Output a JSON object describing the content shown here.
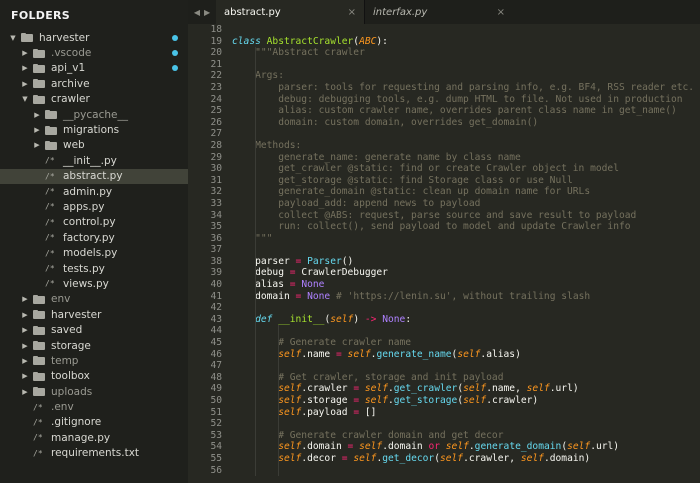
{
  "sidebar": {
    "header": "FOLDERS",
    "items": [
      {
        "label": "harvester",
        "kind": "folder",
        "open": true,
        "depth": 0,
        "dot": true,
        "dim": false
      },
      {
        "label": ".vscode",
        "kind": "folder",
        "open": false,
        "depth": 1,
        "dot": true,
        "dim": true
      },
      {
        "label": "api_v1",
        "kind": "folder",
        "open": false,
        "depth": 1,
        "dot": true,
        "dim": false
      },
      {
        "label": "archive",
        "kind": "folder",
        "open": false,
        "depth": 1,
        "dot": false,
        "dim": false
      },
      {
        "label": "crawler",
        "kind": "folder",
        "open": true,
        "depth": 1,
        "dot": false,
        "dim": false
      },
      {
        "label": "__pycache__",
        "kind": "folder",
        "open": false,
        "depth": 2,
        "dot": false,
        "dim": true
      },
      {
        "label": "migrations",
        "kind": "folder",
        "open": false,
        "depth": 2,
        "dot": false,
        "dim": false
      },
      {
        "label": "web",
        "kind": "folder",
        "open": false,
        "depth": 2,
        "dot": false,
        "dim": false
      },
      {
        "label": "__init__.py",
        "kind": "file",
        "depth": 2,
        "dot": false,
        "dim": false
      },
      {
        "label": "abstract.py",
        "kind": "file",
        "depth": 2,
        "dot": false,
        "dim": false,
        "selected": true
      },
      {
        "label": "admin.py",
        "kind": "file",
        "depth": 2,
        "dot": false,
        "dim": false
      },
      {
        "label": "apps.py",
        "kind": "file",
        "depth": 2,
        "dot": false,
        "dim": false
      },
      {
        "label": "control.py",
        "kind": "file",
        "depth": 2,
        "dot": false,
        "dim": false
      },
      {
        "label": "factory.py",
        "kind": "file",
        "depth": 2,
        "dot": false,
        "dim": false
      },
      {
        "label": "models.py",
        "kind": "file",
        "depth": 2,
        "dot": false,
        "dim": false
      },
      {
        "label": "tests.py",
        "kind": "file",
        "depth": 2,
        "dot": false,
        "dim": false
      },
      {
        "label": "views.py",
        "kind": "file",
        "depth": 2,
        "dot": false,
        "dim": false
      },
      {
        "label": "env",
        "kind": "folder",
        "open": false,
        "depth": 1,
        "dot": false,
        "dim": true
      },
      {
        "label": "harvester",
        "kind": "folder",
        "open": false,
        "depth": 1,
        "dot": false,
        "dim": false
      },
      {
        "label": "saved",
        "kind": "folder",
        "open": false,
        "depth": 1,
        "dot": false,
        "dim": false
      },
      {
        "label": "storage",
        "kind": "folder",
        "open": false,
        "depth": 1,
        "dot": false,
        "dim": false
      },
      {
        "label": "temp",
        "kind": "folder",
        "open": false,
        "depth": 1,
        "dot": false,
        "dim": true
      },
      {
        "label": "toolbox",
        "kind": "folder",
        "open": false,
        "depth": 1,
        "dot": false,
        "dim": false
      },
      {
        "label": "uploads",
        "kind": "folder",
        "open": false,
        "depth": 1,
        "dot": false,
        "dim": true
      },
      {
        "label": ".env",
        "kind": "file",
        "depth": 1,
        "dot": false,
        "dim": true
      },
      {
        "label": ".gitignore",
        "kind": "file",
        "depth": 1,
        "dot": false,
        "dim": false
      },
      {
        "label": "manage.py",
        "kind": "file",
        "depth": 1,
        "dot": false,
        "dim": false
      },
      {
        "label": "requirements.txt",
        "kind": "file",
        "depth": 1,
        "dot": false,
        "dim": false
      }
    ]
  },
  "tabs": [
    {
      "label": "abstract.py",
      "active": true,
      "close": "×"
    },
    {
      "label": "interfax.py",
      "active": false,
      "close": "×"
    }
  ],
  "tab_nav": {
    "left": "◀",
    "right": "▶"
  },
  "editor": {
    "first_line": 18,
    "lines": [
      [],
      [
        [
          "k",
          "class "
        ],
        [
          "n",
          "AbstractCrawler"
        ],
        [
          "",
          "("
        ],
        [
          "p",
          "ABC"
        ],
        [
          "",
          "):"
        ]
      ],
      [
        [
          "st",
          "    \"\"\"Abstract crawler"
        ]
      ],
      [],
      [
        [
          "st",
          "    Args:"
        ]
      ],
      [
        [
          "st",
          "        parser: tools for requesting and parsing info, e.g. BF4, RSS reader etc."
        ]
      ],
      [
        [
          "st",
          "        debug: debugging tools, e.g. dump HTML to file. Not used in production"
        ]
      ],
      [
        [
          "st",
          "        alias: custom crawler name, overrides parent class name in get_name()"
        ]
      ],
      [
        [
          "st",
          "        domain: custom domain, overrides get_domain()"
        ]
      ],
      [],
      [
        [
          "st",
          "    Methods:"
        ]
      ],
      [
        [
          "st",
          "        generate_name: generate name by class name"
        ]
      ],
      [
        [
          "st",
          "        get_crawler @static: find or create Crawler object in model"
        ]
      ],
      [
        [
          "st",
          "        get_storage @static: find Storage class or use Null"
        ]
      ],
      [
        [
          "st",
          "        generate_domain @static: clean up domain name for URLs"
        ]
      ],
      [
        [
          "st",
          "        payload_add: append news to payload"
        ]
      ],
      [
        [
          "st",
          "        collect @ABS: request, parse source and save result to payload"
        ]
      ],
      [
        [
          "st",
          "        run: collect(), send payload to model and update Crawler info"
        ]
      ],
      [
        [
          "st",
          "    \"\"\""
        ]
      ],
      [],
      [
        [
          "",
          "    parser "
        ],
        [
          "kw",
          "="
        ],
        [
          "",
          " "
        ],
        [
          "b",
          "Parser"
        ],
        [
          "",
          "()"
        ]
      ],
      [
        [
          "",
          "    debug "
        ],
        [
          "kw",
          "="
        ],
        [
          "",
          " CrawlerDebugger"
        ]
      ],
      [
        [
          "",
          "    alias "
        ],
        [
          "kw",
          "="
        ],
        [
          "",
          " "
        ],
        [
          "num",
          "None"
        ]
      ],
      [
        [
          "",
          "    domain "
        ],
        [
          "kw",
          "="
        ],
        [
          "",
          " "
        ],
        [
          "num",
          "None"
        ],
        [
          "",
          " "
        ],
        [
          "c",
          "# 'https://lenin.su', without trailing slash"
        ]
      ],
      [],
      [
        [
          "",
          "    "
        ],
        [
          "k",
          "def "
        ],
        [
          "n",
          "__init__"
        ],
        [
          "",
          "("
        ],
        [
          "p",
          "self"
        ],
        [
          "",
          ") "
        ],
        [
          "kw",
          "->"
        ],
        [
          "",
          " "
        ],
        [
          "num",
          "None"
        ],
        [
          "",
          ":"
        ]
      ],
      [],
      [
        [
          "c",
          "        # Generate crawler name"
        ]
      ],
      [
        [
          "",
          "        "
        ],
        [
          "p",
          "self"
        ],
        [
          "",
          ".name "
        ],
        [
          "kw",
          "="
        ],
        [
          "",
          " "
        ],
        [
          "p",
          "self"
        ],
        [
          "",
          "."
        ],
        [
          "b",
          "generate_name"
        ],
        [
          "",
          "("
        ],
        [
          "p",
          "self"
        ],
        [
          "",
          ".alias)"
        ]
      ],
      [],
      [
        [
          "c",
          "        # Get crawler, storage and init payload"
        ]
      ],
      [
        [
          "",
          "        "
        ],
        [
          "p",
          "self"
        ],
        [
          "",
          ".crawler "
        ],
        [
          "kw",
          "="
        ],
        [
          "",
          " "
        ],
        [
          "p",
          "self"
        ],
        [
          "",
          "."
        ],
        [
          "b",
          "get_crawler"
        ],
        [
          "",
          "("
        ],
        [
          "p",
          "self"
        ],
        [
          "",
          ".name, "
        ],
        [
          "p",
          "self"
        ],
        [
          "",
          ".url)"
        ]
      ],
      [
        [
          "",
          "        "
        ],
        [
          "p",
          "self"
        ],
        [
          "",
          ".storage "
        ],
        [
          "kw",
          "="
        ],
        [
          "",
          " "
        ],
        [
          "p",
          "self"
        ],
        [
          "",
          "."
        ],
        [
          "b",
          "get_storage"
        ],
        [
          "",
          "("
        ],
        [
          "p",
          "self"
        ],
        [
          "",
          ".crawler)"
        ]
      ],
      [
        [
          "",
          "        "
        ],
        [
          "p",
          "self"
        ],
        [
          "",
          ".payload "
        ],
        [
          "kw",
          "="
        ],
        [
          "",
          " []"
        ]
      ],
      [],
      [
        [
          "c",
          "        # Generate crawler domain and get decor"
        ]
      ],
      [
        [
          "",
          "        "
        ],
        [
          "p",
          "self"
        ],
        [
          "",
          ".domain "
        ],
        [
          "kw",
          "="
        ],
        [
          "",
          " "
        ],
        [
          "p",
          "self"
        ],
        [
          "",
          ".domain "
        ],
        [
          "kw",
          "or"
        ],
        [
          "",
          " "
        ],
        [
          "p",
          "self"
        ],
        [
          "",
          "."
        ],
        [
          "b",
          "generate_domain"
        ],
        [
          "",
          "("
        ],
        [
          "p",
          "self"
        ],
        [
          "",
          ".url)"
        ]
      ],
      [
        [
          "",
          "        "
        ],
        [
          "p",
          "self"
        ],
        [
          "",
          ".decor "
        ],
        [
          "kw",
          "="
        ],
        [
          "",
          " "
        ],
        [
          "p",
          "self"
        ],
        [
          "",
          "."
        ],
        [
          "b",
          "get_decor"
        ],
        [
          "",
          "("
        ],
        [
          "p",
          "self"
        ],
        [
          "",
          ".crawler, "
        ],
        [
          "p",
          "self"
        ],
        [
          "",
          ".domain)"
        ]
      ],
      []
    ]
  }
}
